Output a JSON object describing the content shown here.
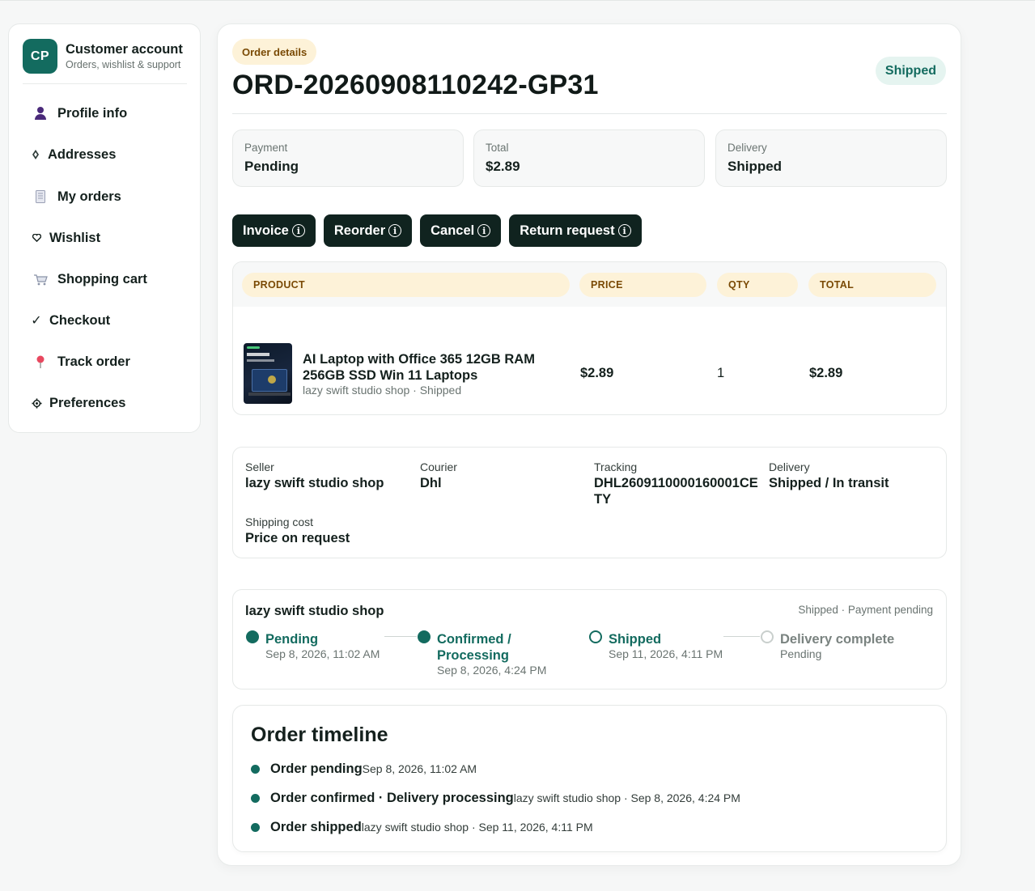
{
  "account": {
    "initials": "CP",
    "title": "Customer account",
    "subtitle": "Orders, wishlist & support"
  },
  "nav": [
    {
      "label": "Profile info",
      "icon": "person-icon"
    },
    {
      "label": "Addresses",
      "icon": "location-icon"
    },
    {
      "label": "My orders",
      "icon": "receipt-icon"
    },
    {
      "label": "Wishlist",
      "icon": "heart-icon"
    },
    {
      "label": "Shopping cart",
      "icon": "cart-icon"
    },
    {
      "label": "Checkout",
      "icon": "check-icon"
    },
    {
      "label": "Track order",
      "icon": "pin-icon"
    },
    {
      "label": "Preferences",
      "icon": "gear-icon"
    }
  ],
  "order": {
    "badge": "Order details",
    "id": "ORD-20260908110242-GP31",
    "status": "Shipped"
  },
  "stats": {
    "payment": {
      "label": "Payment",
      "value": "Pending"
    },
    "total": {
      "label": "Total",
      "value": "$2.89"
    },
    "delivery": {
      "label": "Delivery",
      "value": "Shipped"
    }
  },
  "actions": {
    "invoice": "Invoice",
    "reorder": "Reorder",
    "cancel": "Cancel",
    "return": "Return request",
    "info_glyph": "i"
  },
  "table": {
    "headers": {
      "product": "PRODUCT",
      "price": "PRICE",
      "qty": "QTY",
      "total": "TOTAL"
    },
    "rows": [
      {
        "name": "AI Laptop with Office 365 12GB RAM 256GB SSD Win 11 Laptops",
        "meta": "lazy swift studio shop · Shipped",
        "price": "$2.89",
        "qty": "1",
        "total": "$2.89"
      }
    ]
  },
  "shipping": {
    "seller": {
      "label": "Seller",
      "value": "lazy swift studio shop"
    },
    "courier": {
      "label": "Courier",
      "value": "Dhl"
    },
    "tracking": {
      "label": "Tracking",
      "value": "DHL2609110000160001CETY"
    },
    "delivery": {
      "label": "Delivery",
      "value": "Shipped / In transit"
    },
    "cost": {
      "label": "Shipping cost",
      "value": "Price on request"
    }
  },
  "progress": {
    "shop": "lazy swift studio shop",
    "status": "Shipped · Payment pending",
    "steps": [
      {
        "name": "Pending",
        "date": "Sep 8, 2026, 11:02 AM",
        "state": "done"
      },
      {
        "name": "Confirmed / Processing",
        "date": "Sep 8, 2026, 4:24 PM",
        "state": "done"
      },
      {
        "name": "Shipped",
        "date": "Sep 11, 2026, 4:11 PM",
        "state": "current"
      },
      {
        "name": "Delivery complete",
        "date": "Pending",
        "state": "pending"
      }
    ]
  },
  "timeline": {
    "title": "Order timeline",
    "items": [
      {
        "event": "Order pending",
        "meta": "Sep 8, 2026, 11:02 AM"
      },
      {
        "event": "Order confirmed · Delivery processing",
        "meta": "lazy swift studio shop · Sep 8, 2026, 4:24 PM"
      },
      {
        "event": "Order shipped",
        "meta": "lazy swift studio shop · Sep 11, 2026, 4:11 PM"
      }
    ]
  },
  "colors": {
    "brand": "#136b5f",
    "button": "#10231f",
    "badge_bg": "#fdf2d8",
    "badge_text": "#7a4a05",
    "status_bg": "#e5f4f0"
  }
}
